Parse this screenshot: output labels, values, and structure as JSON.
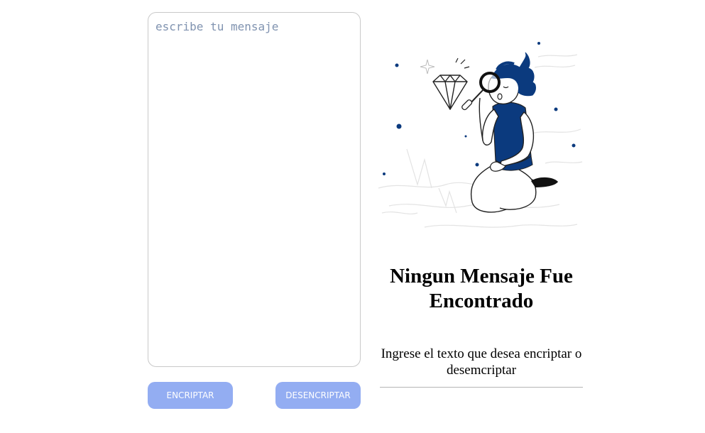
{
  "input": {
    "placeholder": "escribe tu mensaje",
    "value": ""
  },
  "buttons": {
    "encrypt_label": "ENCRIPTAR",
    "decrypt_label": "DESENCRIPTAR"
  },
  "empty_state": {
    "illustration_icon": "person-with-magnifying-glass-and-diamond",
    "title": "Ningun Mensaje Fue Encontrado",
    "subtitle": "Ingrese el texto que desea encriptar o desemcriptar"
  },
  "colors": {
    "button_bg": "#93adf2",
    "accent_navy": "#0b3a7e",
    "placeholder": "#8093b0"
  }
}
